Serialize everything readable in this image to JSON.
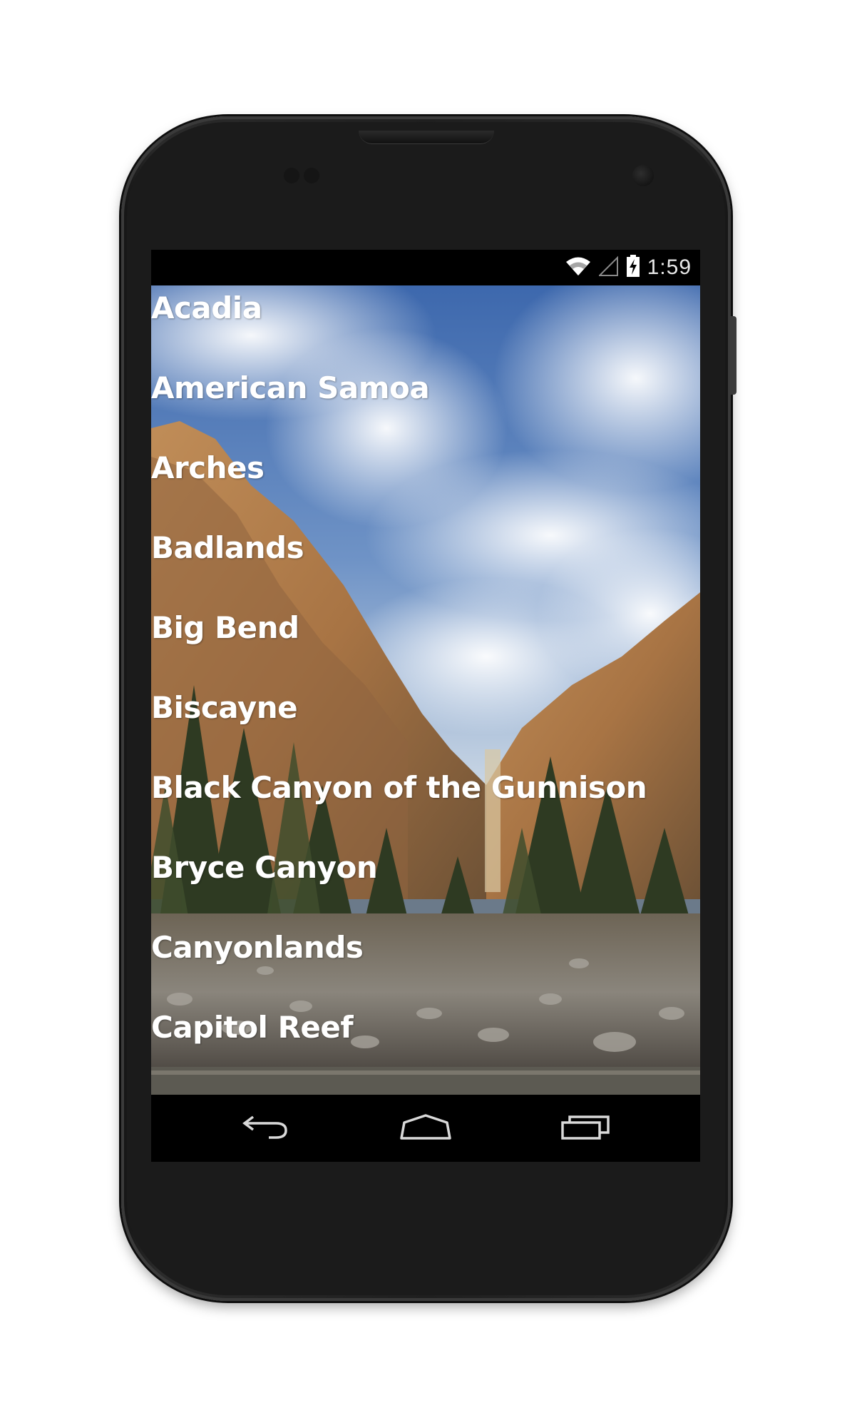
{
  "status_bar": {
    "time": "1:59",
    "icons": [
      "wifi-icon",
      "cell-signal-icon",
      "battery-charging-icon"
    ]
  },
  "parks": [
    "Acadia",
    "American Samoa",
    "Arches",
    "Badlands",
    "Big Bend",
    "Biscayne",
    "Black Canyon of the Gunnison",
    "Bryce Canyon",
    "Canyonlands",
    "Capitol Reef"
  ],
  "nav_bar": {
    "buttons": [
      "back-icon",
      "home-icon",
      "recent-apps-icon"
    ]
  },
  "colors": {
    "list_text": "#ffffff",
    "status_bar_bg": "#000000",
    "nav_bar_bg": "#000000",
    "sky": "#3f6fb5",
    "cliff": "#b9854f"
  }
}
